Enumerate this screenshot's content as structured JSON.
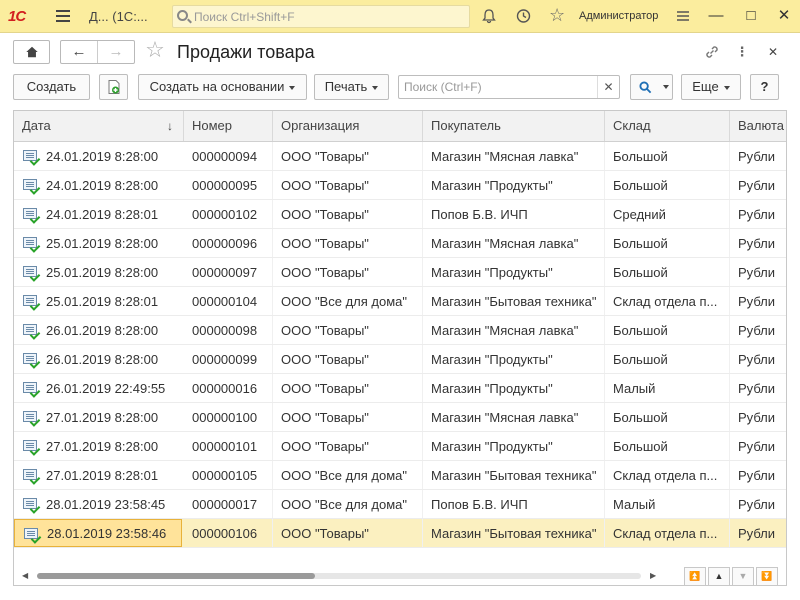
{
  "app": {
    "logo": "1С",
    "title": "Д...  (1С:...",
    "search_placeholder": "Поиск Ctrl+Shift+F",
    "user": "Администратор"
  },
  "window": {
    "title": "Продажи товара"
  },
  "toolbar": {
    "create": "Создать",
    "create_based": "Создать на основании",
    "print": "Печать",
    "search_placeholder": "Поиск (Ctrl+F)",
    "more": "Еще",
    "help": "?"
  },
  "table": {
    "columns": [
      "Дата",
      "Номер",
      "Организация",
      "Покупатель",
      "Склад",
      "Валюта"
    ],
    "rows": [
      {
        "date": "24.01.2019 8:28:00",
        "number": "000000094",
        "org": "ООО \"Товары\"",
        "buyer": "Магазин \"Мясная лавка\"",
        "store": "Большой",
        "currency": "Рубли"
      },
      {
        "date": "24.01.2019 8:28:00",
        "number": "000000095",
        "org": "ООО \"Товары\"",
        "buyer": "Магазин \"Продукты\"",
        "store": "Большой",
        "currency": "Рубли"
      },
      {
        "date": "24.01.2019 8:28:01",
        "number": "000000102",
        "org": "ООО \"Товары\"",
        "buyer": "Попов Б.В. ИЧП",
        "store": "Средний",
        "currency": "Рубли"
      },
      {
        "date": "25.01.2019 8:28:00",
        "number": "000000096",
        "org": "ООО \"Товары\"",
        "buyer": "Магазин \"Мясная лавка\"",
        "store": "Большой",
        "currency": "Рубли"
      },
      {
        "date": "25.01.2019 8:28:00",
        "number": "000000097",
        "org": "ООО \"Товары\"",
        "buyer": "Магазин \"Продукты\"",
        "store": "Большой",
        "currency": "Рубли"
      },
      {
        "date": "25.01.2019 8:28:01",
        "number": "000000104",
        "org": "ООО \"Все для дома\"",
        "buyer": "Магазин \"Бытовая техника\"",
        "store": "Склад отдела п...",
        "currency": "Рубли"
      },
      {
        "date": "26.01.2019 8:28:00",
        "number": "000000098",
        "org": "ООО \"Товары\"",
        "buyer": "Магазин \"Мясная лавка\"",
        "store": "Большой",
        "currency": "Рубли"
      },
      {
        "date": "26.01.2019 8:28:00",
        "number": "000000099",
        "org": "ООО \"Товары\"",
        "buyer": "Магазин \"Продукты\"",
        "store": "Большой",
        "currency": "Рубли"
      },
      {
        "date": "26.01.2019 22:49:55",
        "number": "000000016",
        "org": "ООО \"Товары\"",
        "buyer": "Магазин \"Продукты\"",
        "store": "Малый",
        "currency": "Рубли"
      },
      {
        "date": "27.01.2019 8:28:00",
        "number": "000000100",
        "org": "ООО \"Товары\"",
        "buyer": "Магазин \"Мясная лавка\"",
        "store": "Большой",
        "currency": "Рубли"
      },
      {
        "date": "27.01.2019 8:28:00",
        "number": "000000101",
        "org": "ООО \"Товары\"",
        "buyer": "Магазин \"Продукты\"",
        "store": "Большой",
        "currency": "Рубли"
      },
      {
        "date": "27.01.2019 8:28:01",
        "number": "000000105",
        "org": "ООО \"Все для дома\"",
        "buyer": "Магазин \"Бытовая техника\"",
        "store": "Склад отдела п...",
        "currency": "Рубли"
      },
      {
        "date": "28.01.2019 23:58:45",
        "number": "000000017",
        "org": "ООО \"Все для дома\"",
        "buyer": "Попов Б.В. ИЧП",
        "store": "Малый",
        "currency": "Рубли"
      },
      {
        "date": "28.01.2019 23:58:46",
        "number": "000000106",
        "org": "ООО \"Товары\"",
        "buyer": "Магазин \"Бытовая техника\"",
        "store": "Склад отдела п...",
        "currency": "Рубли",
        "selected": true
      }
    ]
  },
  "scroll": {
    "horizontal_position": 0.46
  }
}
